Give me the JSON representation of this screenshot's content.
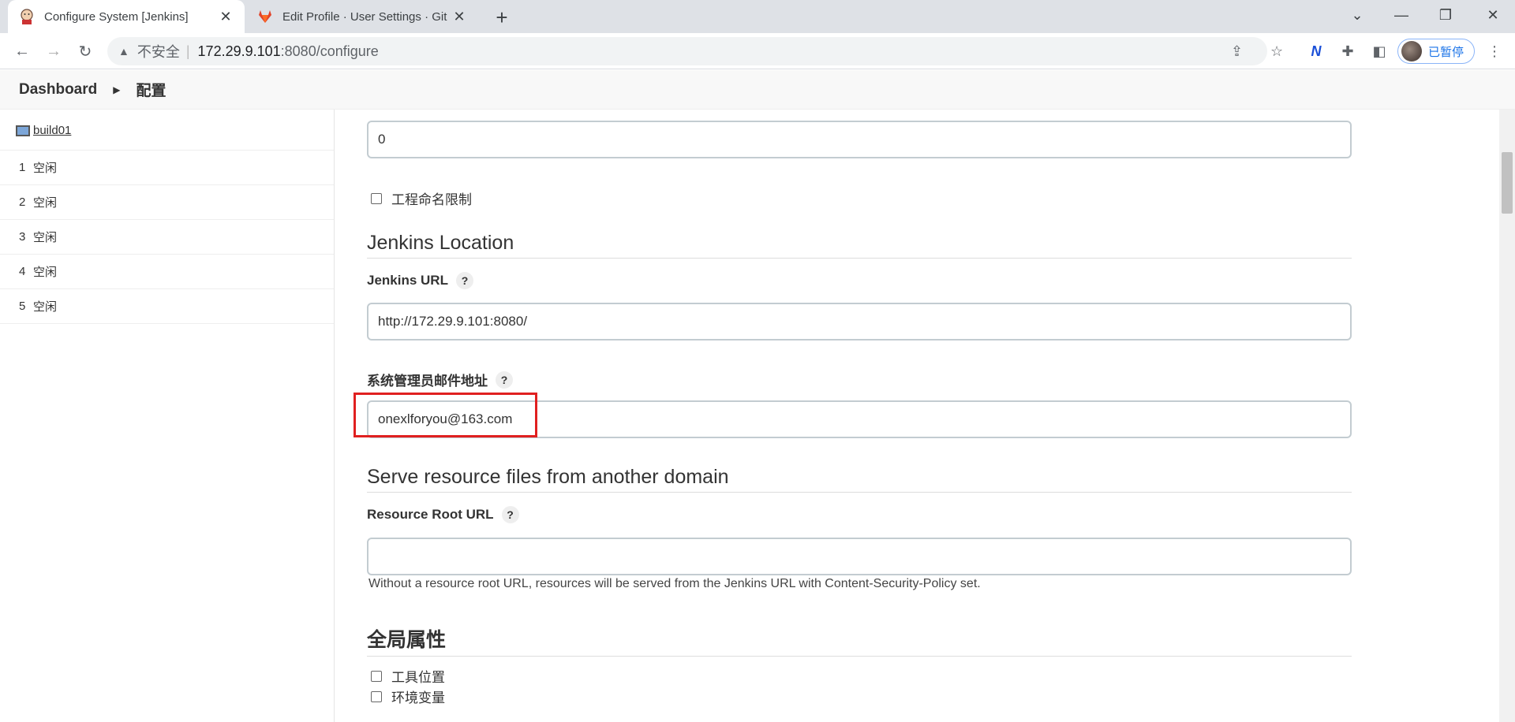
{
  "browser": {
    "tabs": [
      {
        "title": "Configure System [Jenkins]",
        "active": true,
        "icon": "jenkins-icon"
      },
      {
        "title": "Edit Profile · User Settings · Git",
        "active": false,
        "icon": "gitlab-icon"
      }
    ],
    "address": {
      "warning": "不安全",
      "host": "172.29.9.101",
      "path": ":8080/configure"
    },
    "profile_label": "已暂停"
  },
  "breadcrumb": {
    "dashboard": "Dashboard",
    "current": "配置"
  },
  "executors": {
    "node": "build01",
    "rows": [
      {
        "num": "1",
        "status": "空闲"
      },
      {
        "num": "2",
        "status": "空闲"
      },
      {
        "num": "3",
        "status": "空闲"
      },
      {
        "num": "4",
        "status": "空闲"
      },
      {
        "num": "5",
        "status": "空闲"
      }
    ]
  },
  "form": {
    "top_value": "0",
    "project_naming": "工程命名限制",
    "jenkins_location_title": "Jenkins Location",
    "jenkins_url_label": "Jenkins URL",
    "jenkins_url_value": "http://172.29.9.101:8080/",
    "admin_email_label": "系统管理员邮件地址",
    "admin_email_value": "onexlforyou@163.com",
    "serve_resource_title": "Serve resource files from another domain",
    "resource_root_label": "Resource Root URL",
    "resource_root_value": "",
    "resource_root_hint": "Without a resource root URL, resources will be served from the Jenkins URL with Content-Security-Policy set.",
    "global_props_title": "全局属性",
    "tool_location": "工具位置",
    "env_vars": "环境变量",
    "help_mark": "?"
  }
}
